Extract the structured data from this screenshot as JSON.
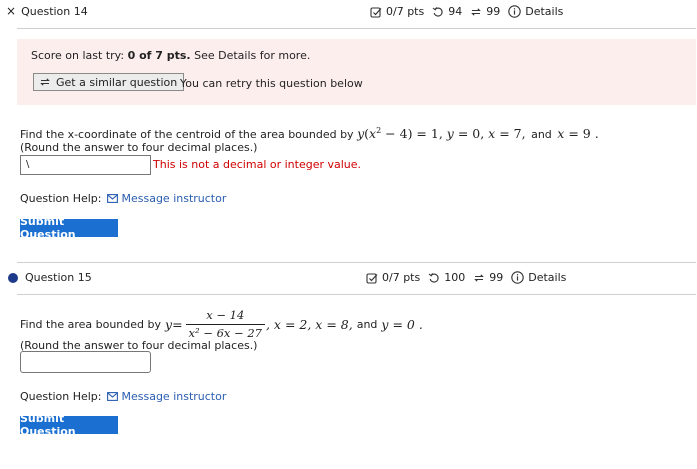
{
  "q14": {
    "title": "Question 14",
    "meta": {
      "pts": "0/7 pts",
      "retries": "94",
      "attempts": "99",
      "details": "Details"
    },
    "feedback": {
      "score_prefix": "Score on last try: ",
      "score_value": "0 of 7 pts.",
      "score_suffix": " See Details for more.",
      "similar_button": "Get a similar question",
      "retry_text": "You can retry this question below"
    },
    "prompt_prefix": "Find the x-coordinate of the centroid of the area bounded by",
    "math": {
      "y": "y",
      "open": "(",
      "x": "x",
      "sup": "2",
      "minus4": " − 4",
      "close": ")",
      "eq1": " = 1, ",
      "y2": "y",
      "eq0": " = 0, ",
      "x2": "x",
      "eq7": " = 7,",
      "and": "and",
      "x3": "x",
      "eq9": " = 9 ."
    },
    "round_note": "(Round the answer to four decimal places.)",
    "answer_value": "\\",
    "error_text": "This is not a decimal or integer value.",
    "help_label": "Question Help:",
    "help_link": "Message instructor",
    "submit": "Submit Question"
  },
  "q15": {
    "title": "Question 15",
    "meta": {
      "pts": "0/7 pts",
      "retries": "100",
      "attempts": "99",
      "details": "Details"
    },
    "prompt_prefix": "Find the area bounded by",
    "math": {
      "y": "y",
      "eq": " =",
      "num": "x − 14",
      "den": "x² − 6x − 27",
      "tail": ", x = 2, x = 8,",
      "and": "and",
      "y0": "y = 0 ."
    },
    "round_note": "(Round the answer to four decimal places.)",
    "answer_value": "",
    "help_label": "Question Help:",
    "help_link": "Message instructor",
    "submit": "Submit Question"
  },
  "colors": {
    "accent": "#1a6fd0",
    "feedback_bg": "#fdeeee",
    "error": "#d00000",
    "bullet": "#1e3a8a"
  }
}
